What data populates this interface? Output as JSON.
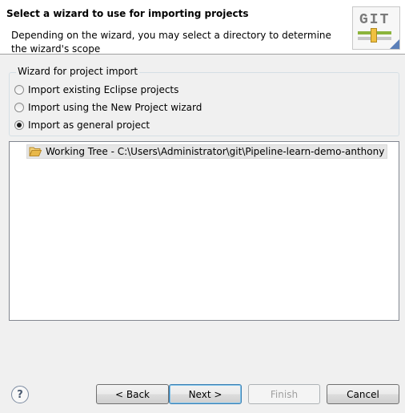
{
  "header": {
    "title": "Select a wizard to use for importing projects",
    "description": "Depending on the wizard, you may select a directory to determine the wizard's scope",
    "logo_text": "GIT"
  },
  "wizard_group": {
    "legend": "Wizard for project import",
    "options": [
      {
        "label": "Import existing Eclipse projects",
        "checked": false
      },
      {
        "label": "Import using the New Project wizard",
        "checked": false
      },
      {
        "label": "Import as general project",
        "checked": true
      }
    ]
  },
  "tree": {
    "items": [
      {
        "label": "Working Tree - C:\\Users\\Administrator\\git\\Pipeline-learn-demo-anthony",
        "icon": "folder-icon"
      }
    ]
  },
  "footer": {
    "help_glyph": "?",
    "back_label": "< Back",
    "next_label": "Next >",
    "finish_label": "Finish",
    "cancel_label": "Cancel"
  },
  "colors": {
    "folder": "#e8b84a",
    "selection": "#e6e6e6",
    "default_button_border": "#3c7fb1"
  }
}
